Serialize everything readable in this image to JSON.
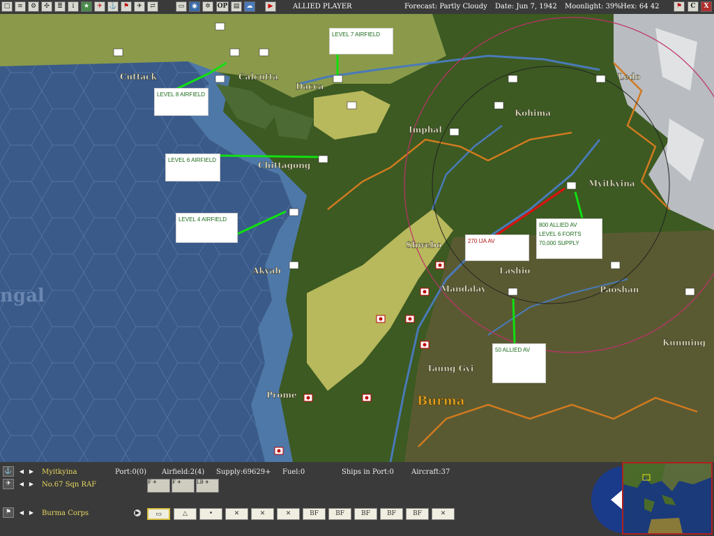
{
  "top_bar": {
    "player": "ALLIED PLAYER",
    "forecast": "Forecast: Partly Cloudy",
    "date": "Date: Jun 7, 1942",
    "moonlight": "Moonlight: 39%",
    "hex": "Hex: 64 42",
    "op_button": "OP",
    "close_button": "C",
    "exit_button": "X"
  },
  "map": {
    "sea_label": "ngal",
    "region_label": "Burma",
    "cities": [
      "Cuttack",
      "Calcutta",
      "Dacca",
      "Ledo",
      "Kohima",
      "Imphal",
      "Chittagong",
      "Myitkyina",
      "Akyab",
      "Shwebo",
      "Lashio",
      "Mandalay",
      "Paoshan",
      "Kunming",
      "Taung Gyi",
      "Prome"
    ],
    "annotations": {
      "level7": "LEVEL 7 AIRFIELD",
      "level8": "LEVEL 8 AIRFIELD",
      "level6": "LEVEL 6 AIRFIELD",
      "level4": "LEVEL 4 AIRFIELD",
      "ija": "270 IJA AV",
      "allied_av": "800 ALLIED AV",
      "forts": "LEVEL 6 FORTS",
      "supply": "70,000 SUPPLY",
      "lashio": "50 ALLIED AV"
    },
    "colors": {
      "sea": "#3a5a8a",
      "shallow": "#4e78a8",
      "jungle": "#3c5a22",
      "clear": "#b8b85c",
      "mountain": "#c8c8c8"
    }
  },
  "info_panel": {
    "base_name": "Myitkyina",
    "port": "Port:0(0)",
    "airfield": "Airfield:2(4)",
    "supply": "Supply:69629+",
    "fuel": "Fuel:0",
    "ships": "Ships in Port:0",
    "aircraft": "Aircraft:37",
    "squadron": "No.67 Sqn RAF",
    "air_units": [
      "F",
      "F",
      "LB"
    ],
    "ground_unit": "Burma Corps",
    "unit_boxes": [
      "",
      "",
      "",
      "",
      "",
      "",
      "BF",
      "BF",
      "BF",
      "BF",
      "BF",
      ""
    ]
  }
}
